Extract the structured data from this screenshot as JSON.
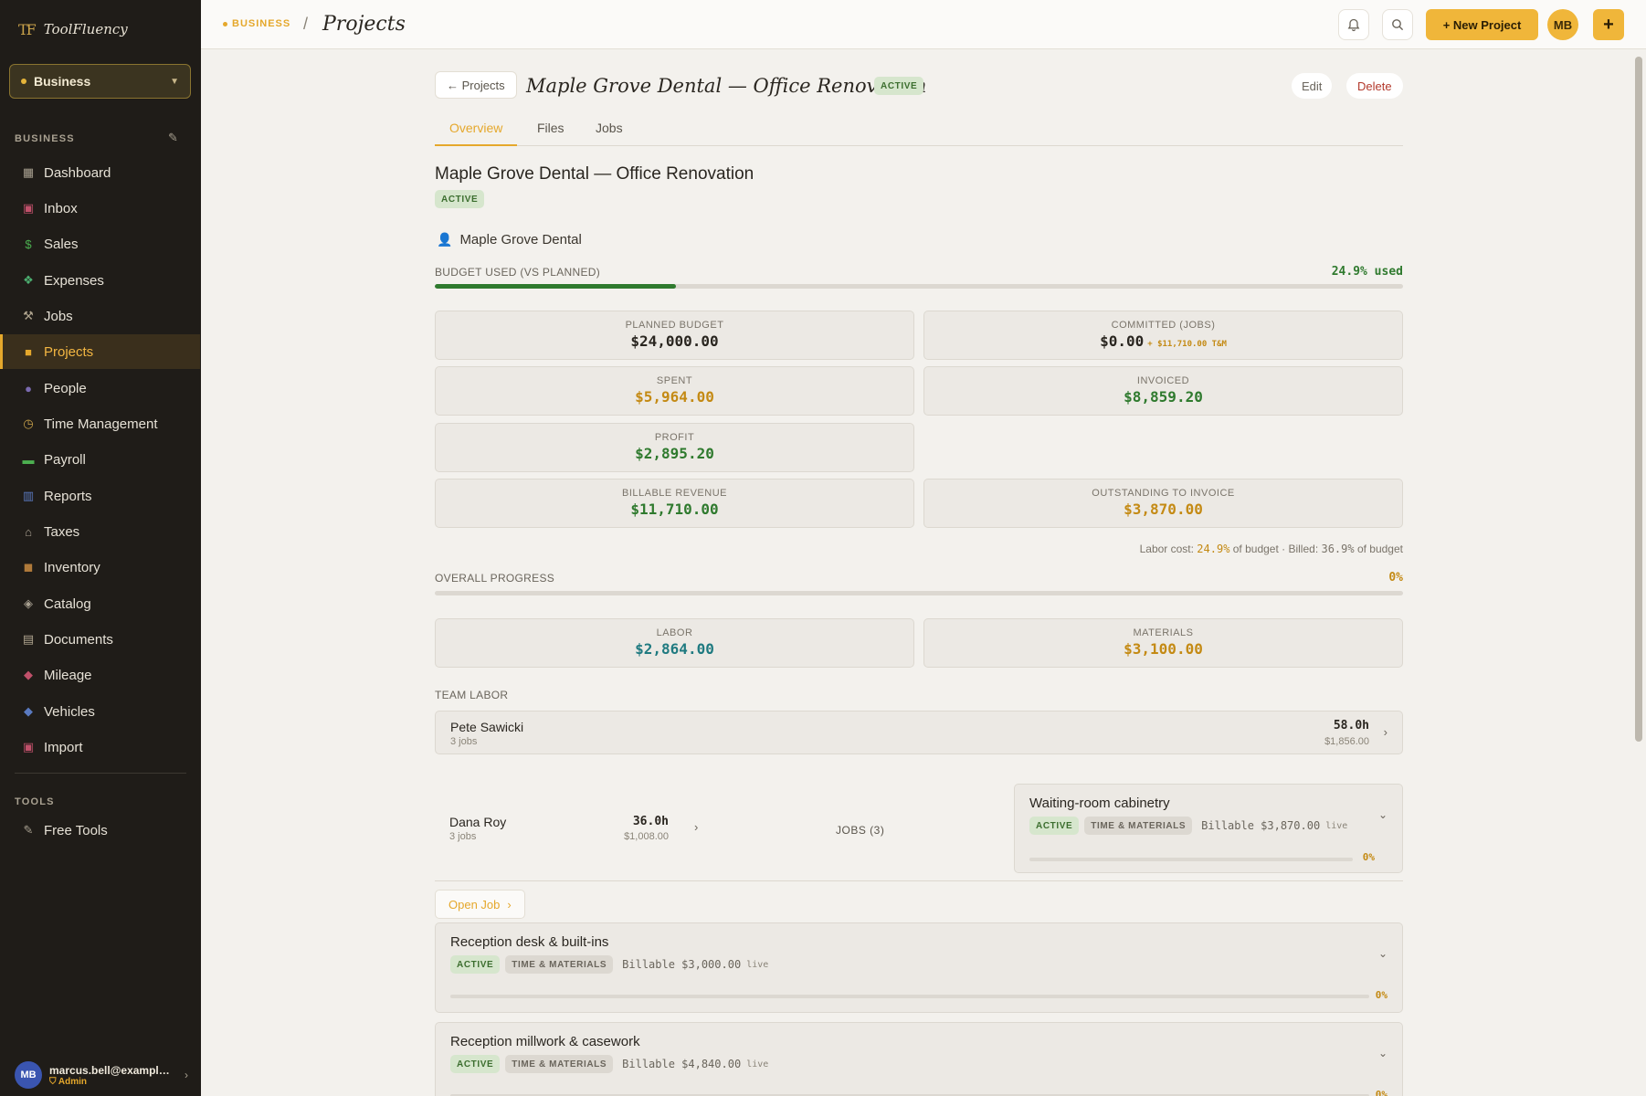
{
  "sidebar": {
    "logo_mark": "TF",
    "logo_text": "ToolFluency",
    "business_select": "Business",
    "section_business": "BUSINESS",
    "section_tools": "TOOLS",
    "items": [
      {
        "label": "Dashboard",
        "icon": "grid-icon"
      },
      {
        "label": "Inbox",
        "icon": "inbox-icon"
      },
      {
        "label": "Sales",
        "icon": "dollar-icon"
      },
      {
        "label": "Expenses",
        "icon": "money-wings-icon"
      },
      {
        "label": "Jobs",
        "icon": "hammer-icon"
      },
      {
        "label": "Projects",
        "icon": "folder-icon"
      },
      {
        "label": "People",
        "icon": "people-icon"
      },
      {
        "label": "Time Management",
        "icon": "stopwatch-icon"
      },
      {
        "label": "Payroll",
        "icon": "banknote-icon"
      },
      {
        "label": "Reports",
        "icon": "bar-chart-icon"
      },
      {
        "label": "Taxes",
        "icon": "bank-icon"
      },
      {
        "label": "Inventory",
        "icon": "box-icon"
      },
      {
        "label": "Catalog",
        "icon": "tag-icon"
      },
      {
        "label": "Documents",
        "icon": "document-icon"
      },
      {
        "label": "Mileage",
        "icon": "car-icon"
      },
      {
        "label": "Vehicles",
        "icon": "truck-icon"
      },
      {
        "label": "Import",
        "icon": "import-icon"
      }
    ],
    "tools": [
      {
        "label": "Free Tools",
        "icon": "wrench-icon"
      }
    ],
    "active_item": "Projects",
    "user": {
      "initials": "MB",
      "email": "marcus.bell@example...",
      "role": "Admin"
    }
  },
  "header": {
    "breadcrumb_business": "BUSINESS",
    "breadcrumb_sep": "/",
    "page": "Projects",
    "new_project": "+ New Project",
    "avatar": "MB",
    "plus": "+"
  },
  "project": {
    "back": "← Projects",
    "title": "Maple Grove Dental — Office Renovation",
    "status": "ACTIVE",
    "edit": "Edit",
    "delete": "Delete",
    "tabs": [
      "Overview",
      "Files",
      "Jobs"
    ],
    "client": "Maple Grove Dental"
  },
  "budget": {
    "label": "BUDGET USED (VS PLANNED)",
    "used_text": "24.9% used",
    "used_fraction": 0.249,
    "stats": {
      "planned_label": "PLANNED BUDGET",
      "planned": "$24,000.00",
      "committed_label": "COMMITTED (JOBS)",
      "committed": "$0.00",
      "committed_tm": "+ $11,710.00 T&M",
      "spent_label": "SPENT",
      "spent": "$5,964.00",
      "invoiced_label": "INVOICED",
      "invoiced": "$8,859.20",
      "profit_label": "PROFIT",
      "profit": "$2,895.20",
      "billable_label": "BILLABLE REVENUE",
      "billable": "$11,710.00",
      "outstanding_label": "OUTSTANDING TO INVOICE",
      "outstanding": "$3,870.00"
    },
    "footnote_prefix": "Labor cost: ",
    "footnote_labor": "24.9%",
    "footnote_mid": " of budget · Billed: ",
    "footnote_billed": "36.9%",
    "footnote_suffix": " of budget"
  },
  "progress": {
    "label": "OVERALL PROGRESS",
    "value": "0%",
    "fraction": 0,
    "labor_label": "LABOR",
    "labor": "$2,864.00",
    "materials_label": "MATERIALS",
    "materials": "$3,100.00"
  },
  "team": {
    "label": "TEAM LABOR",
    "members": [
      {
        "name": "Pete Sawicki",
        "jobs": "3 jobs",
        "hours": "58.0h",
        "amount": "$1,856.00"
      },
      {
        "name": "Dana Roy",
        "jobs": "3 jobs",
        "hours": "36.0h",
        "amount": "$1,008.00"
      }
    ]
  },
  "jobs": {
    "label": "JOBS (3)",
    "open_job": "Open Job",
    "items": [
      {
        "name": "Waiting-room cabinetry",
        "status": "ACTIVE",
        "type": "TIME & MATERIALS",
        "billable": "Billable $3,870.00",
        "live": "live",
        "progress": "0%"
      },
      {
        "name": "Reception desk & built-ins",
        "status": "ACTIVE",
        "type": "TIME & MATERIALS",
        "billable": "Billable $3,000.00",
        "live": "live",
        "progress": "0%"
      },
      {
        "name": "Reception millwork & casework",
        "status": "ACTIVE",
        "type": "TIME & MATERIALS",
        "billable": "Billable $4,840.00",
        "live": "live",
        "progress": "0%"
      }
    ]
  },
  "colors": {
    "accent": "#f0b63a",
    "green": "#2f7a2e",
    "amber": "#c48a14",
    "teal": "#1f7a80",
    "sidebar": "#1f1c18"
  }
}
